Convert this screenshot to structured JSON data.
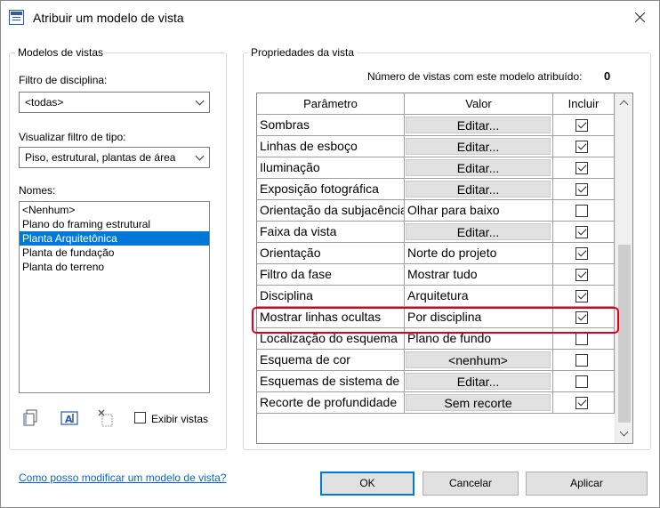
{
  "window": {
    "title": "Atribuir um modelo de vista"
  },
  "left_panel": {
    "group_title": "Modelos de vistas",
    "discipline_filter": {
      "label": "Filtro de disciplina:",
      "value": "<todas>"
    },
    "type_filter": {
      "label": "Visualizar filtro de tipo:",
      "value": "Piso, estrutural, plantas de área"
    },
    "names": {
      "label": "Nomes:",
      "items": [
        {
          "label": "<Nenhum>",
          "selected": false
        },
        {
          "label": "Plano do framing estrutural",
          "selected": false
        },
        {
          "label": "Planta Arquitetônica",
          "selected": true
        },
        {
          "label": "Planta de fundação",
          "selected": false
        },
        {
          "label": "Planta do terreno",
          "selected": false
        }
      ]
    },
    "tools": {
      "duplicate_icon": "duplicate-icon",
      "rename_icon": "rename-icon",
      "delete_icon": "delete-icon"
    },
    "show_views": {
      "label": "Exibir vistas",
      "checked": false
    }
  },
  "right_panel": {
    "group_title": "Propriedades da vista",
    "count_label": "Número de vistas com este modelo atribuído:",
    "count_value": "0",
    "table": {
      "headers": {
        "param": "Parâmetro",
        "value": "Valor",
        "include": "Incluir"
      },
      "rows": [
        {
          "param": "Sombras",
          "value": "Editar...",
          "value_is_button": true,
          "include": true
        },
        {
          "param": "Linhas de esboço",
          "value": "Editar...",
          "value_is_button": true,
          "include": true
        },
        {
          "param": "Iluminação",
          "value": "Editar...",
          "value_is_button": true,
          "include": true
        },
        {
          "param": "Exposição fotográfica",
          "value": "Editar...",
          "value_is_button": true,
          "include": true
        },
        {
          "param": "Orientação da subjacência",
          "value": "Olhar para baixo",
          "value_is_button": false,
          "include": false
        },
        {
          "param": "Faixa da vista",
          "value": "Editar...",
          "value_is_button": true,
          "include": true
        },
        {
          "param": "Orientação",
          "value": "Norte do projeto",
          "value_is_button": false,
          "include": true
        },
        {
          "param": "Filtro da fase",
          "value": "Mostrar tudo",
          "value_is_button": false,
          "include": true
        },
        {
          "param": "Disciplina",
          "value": "Arquitetura",
          "value_is_button": false,
          "include": true
        },
        {
          "param": "Mostrar linhas ocultas",
          "value": "Por disciplina",
          "value_is_button": false,
          "include": true
        },
        {
          "param": "Localização do esquema",
          "value": "Plano de fundo",
          "value_is_button": false,
          "include": false
        },
        {
          "param": "Esquema de cor",
          "value": "<nenhum>",
          "value_is_button": true,
          "include": false
        },
        {
          "param": "Esquemas de sistema de",
          "value": "Editar...",
          "value_is_button": true,
          "include": false
        },
        {
          "param": "Recorte de profundidade",
          "value": "Sem recorte",
          "value_is_button": true,
          "include": true
        }
      ]
    }
  },
  "footer": {
    "help_link": "Como posso modificar um modelo de vista?",
    "ok_label": "OK",
    "cancel_label": "Cancelar",
    "apply_label": "Aplicar"
  },
  "colors": {
    "selection": "#0078d7",
    "highlight_box": "#e0001b",
    "link": "#0066cc"
  }
}
